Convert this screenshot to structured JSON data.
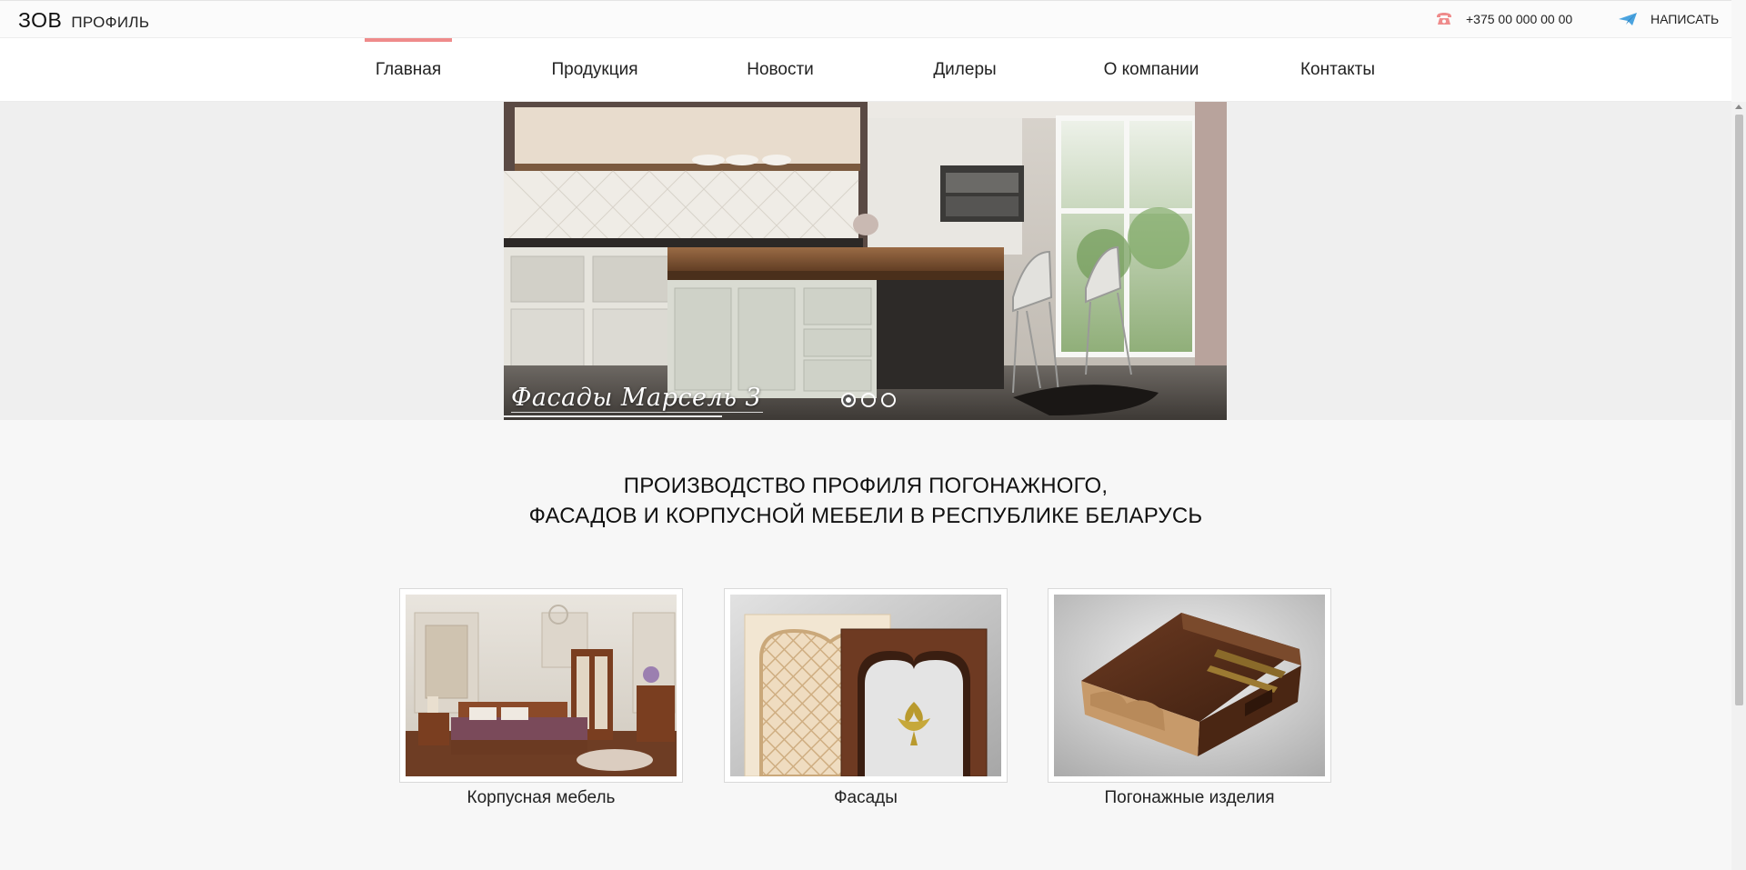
{
  "header": {
    "logo_main": "ЗОВ",
    "logo_sub": "ПРОФИЛЬ",
    "phone": "+375 00 000 00 00",
    "write_label": "НАПИСАТЬ",
    "phone_icon": "phone-icon",
    "write_icon": "paper-plane-icon",
    "accent_color": "#ef8b8b",
    "plane_color": "#4aa3df"
  },
  "nav": {
    "items": [
      {
        "label": "Главная",
        "active": true
      },
      {
        "label": "Продукция"
      },
      {
        "label": "Новости"
      },
      {
        "label": "Дилеры"
      },
      {
        "label": "О компании"
      },
      {
        "label": "Контакты"
      }
    ]
  },
  "slider": {
    "caption": "Фасады Марсель 3",
    "slide_count": 3,
    "active_index": 0
  },
  "headline": {
    "line1": "ПРОИЗВОДСТВО ПРОФИЛЯ ПОГОНАЖНОГО,",
    "line2": "ФАСАДОВ И КОРПУСНОЙ МЕБЕЛИ В РЕСПУБЛИКЕ БЕЛАРУСЬ"
  },
  "categories": [
    {
      "label": "Корпусная мебель"
    },
    {
      "label": "Фасады"
    },
    {
      "label": "Погонажные изделия"
    }
  ]
}
